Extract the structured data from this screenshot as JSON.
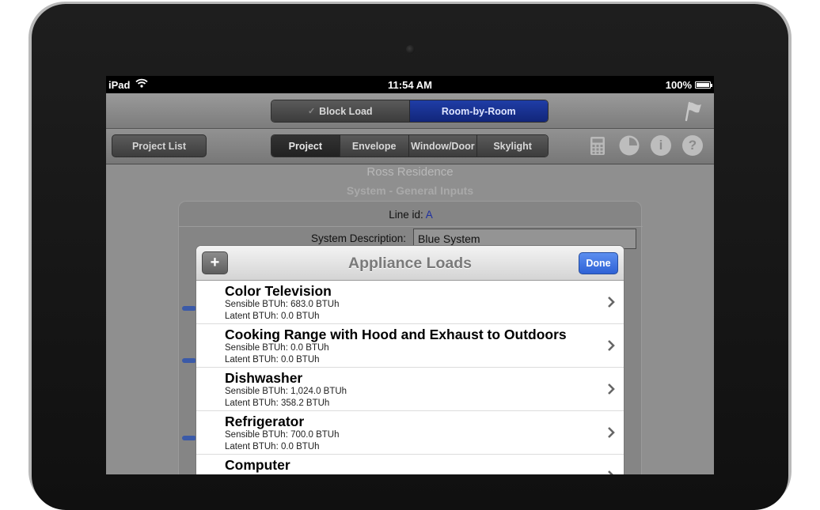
{
  "status": {
    "carrier": "iPad",
    "time": "11:54 AM",
    "battery": "100%"
  },
  "top_segment": {
    "items": [
      "Block Load",
      "Room-by-Room"
    ],
    "selected": "Room-by-Room"
  },
  "toolbar": {
    "project_list": "Project List",
    "tabs": [
      "Project",
      "Envelope",
      "Window/Door",
      "Skylight"
    ],
    "selected_tab": "Project"
  },
  "content": {
    "title": "Ross Residence",
    "subtitle": "System - General Inputs",
    "line_id_label": "Line id:",
    "line_id_value": "A",
    "system_desc_label": "System Description:",
    "system_desc_value": "Blue System"
  },
  "modal": {
    "title": "Appliance Loads",
    "add_label": "+",
    "done_label": "Done",
    "items": [
      {
        "name": "Color Television",
        "sensible": "Sensible BTUh: 683.0 BTUh",
        "latent": "Latent BTUh: 0.0 BTUh"
      },
      {
        "name": "Cooking Range with Hood and Exhaust to Outdoors",
        "sensible": "Sensible BTUh: 0.0 BTUh",
        "latent": "Latent BTUh: 0.0 BTUh"
      },
      {
        "name": "Dishwasher",
        "sensible": "Sensible BTUh: 1,024.0 BTUh",
        "latent": "Latent BTUh: 358.2 BTUh"
      },
      {
        "name": "Refrigerator",
        "sensible": "Sensible BTUh: 700.0 BTUh",
        "latent": "Latent BTUh: 0.0 BTUh"
      },
      {
        "name": "Computer",
        "sensible": "",
        "latent": ""
      }
    ]
  },
  "icons": [
    "calculator-icon",
    "pie-chart-icon",
    "info-icon",
    "help-icon",
    "flag-icon",
    "chevron-right-icon"
  ],
  "colors": {
    "selected_blue": "#1f3da6",
    "done_blue": "#2f62d6"
  }
}
